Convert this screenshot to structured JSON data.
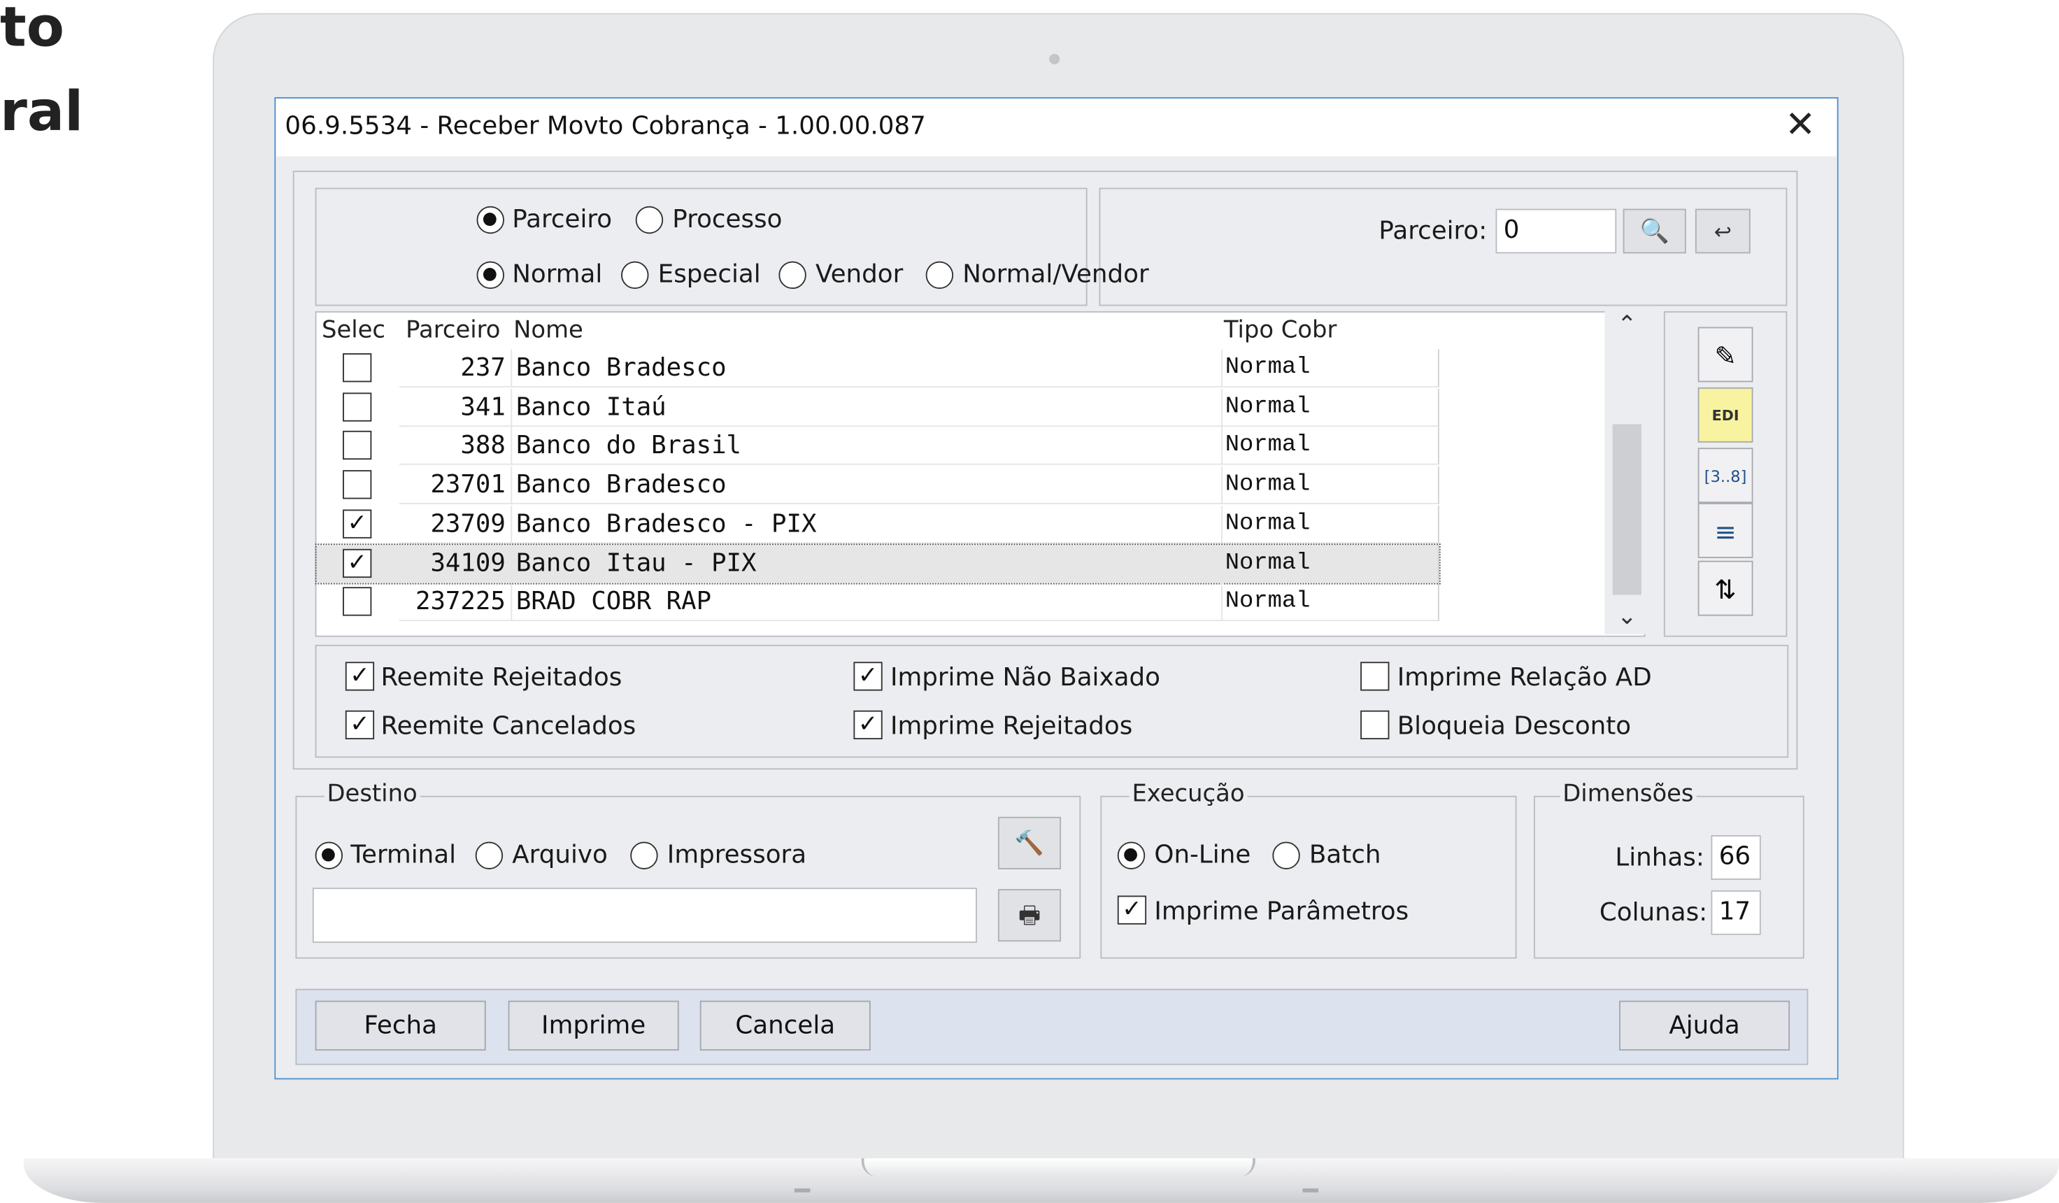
{
  "page_text": {
    "line1": "to",
    "line2": "ral"
  },
  "window": {
    "title": "06.9.5534 - Receber Movto Cobrança - 1.00.00.087",
    "close_symbol": "✕"
  },
  "filters": {
    "mode_options": [
      "Parceiro",
      "Processo"
    ],
    "selected_mode": "Parceiro",
    "type_options": [
      "Normal",
      "Especial",
      "Vendor",
      "Normal/Vendor"
    ],
    "selected_type": "Normal",
    "parceiro_label": "Parceiro:",
    "parceiro_value": "0"
  },
  "grid": {
    "columns": [
      "Selec",
      "Parceiro",
      "Nome",
      "Tipo Cobr"
    ],
    "rows": [
      {
        "checked": false,
        "parceiro": "237",
        "nome": "Banco Bradesco",
        "tipo": "Normal"
      },
      {
        "checked": false,
        "parceiro": "341",
        "nome": "Banco Itaú",
        "tipo": "Normal"
      },
      {
        "checked": false,
        "parceiro": "388",
        "nome": "Banco do Brasil",
        "tipo": "Normal"
      },
      {
        "checked": false,
        "parceiro": "23701",
        "nome": "Banco Bradesco",
        "tipo": "Normal"
      },
      {
        "checked": true,
        "parceiro": "23709",
        "nome": "Banco Bradesco - PIX",
        "tipo": "Normal"
      },
      {
        "checked": true,
        "parceiro": "34109",
        "nome": "Banco Itau - PIX",
        "tipo": "Normal",
        "focused": true
      },
      {
        "checked": false,
        "parceiro": "237225",
        "nome": "BRAD COBR RAP",
        "tipo": "Normal"
      }
    ]
  },
  "toolbar_icons": [
    "edit-pencil-icon",
    "edi-file-icon",
    "sequence-icon",
    "select-all-icon",
    "deselect-all-icon"
  ],
  "options": {
    "reemite_rejeitados": {
      "label": "Reemite Rejeitados",
      "checked": true
    },
    "reemite_cancelados": {
      "label": "Reemite Cancelados",
      "checked": true
    },
    "imprime_nao_baixado": {
      "label": "Imprime Não Baixado",
      "checked": true
    },
    "imprime_rejeitados": {
      "label": "Imprime Rejeitados",
      "checked": true
    },
    "imprime_relacao_ad": {
      "label": "Imprime Relação AD",
      "checked": false
    },
    "bloqueia_desconto": {
      "label": "Bloqueia Desconto",
      "checked": false
    }
  },
  "destino": {
    "legend": "Destino",
    "options": [
      "Terminal",
      "Arquivo",
      "Impressora"
    ],
    "selected": "Terminal",
    "file_value": ""
  },
  "execucao": {
    "legend": "Execução",
    "options": [
      "On-Line",
      "Batch"
    ],
    "selected": "On-Line",
    "imprime_parametros": {
      "label": "Imprime Parâmetros",
      "checked": true
    }
  },
  "dimensoes": {
    "legend": "Dimensões",
    "linhas_label": "Linhas:",
    "linhas_value": "66",
    "colunas_label": "Colunas:",
    "colunas_value": "17"
  },
  "buttons": {
    "fecha": "Fecha",
    "imprime": "Imprime",
    "cancela": "Cancela",
    "ajuda": "Ajuda"
  }
}
